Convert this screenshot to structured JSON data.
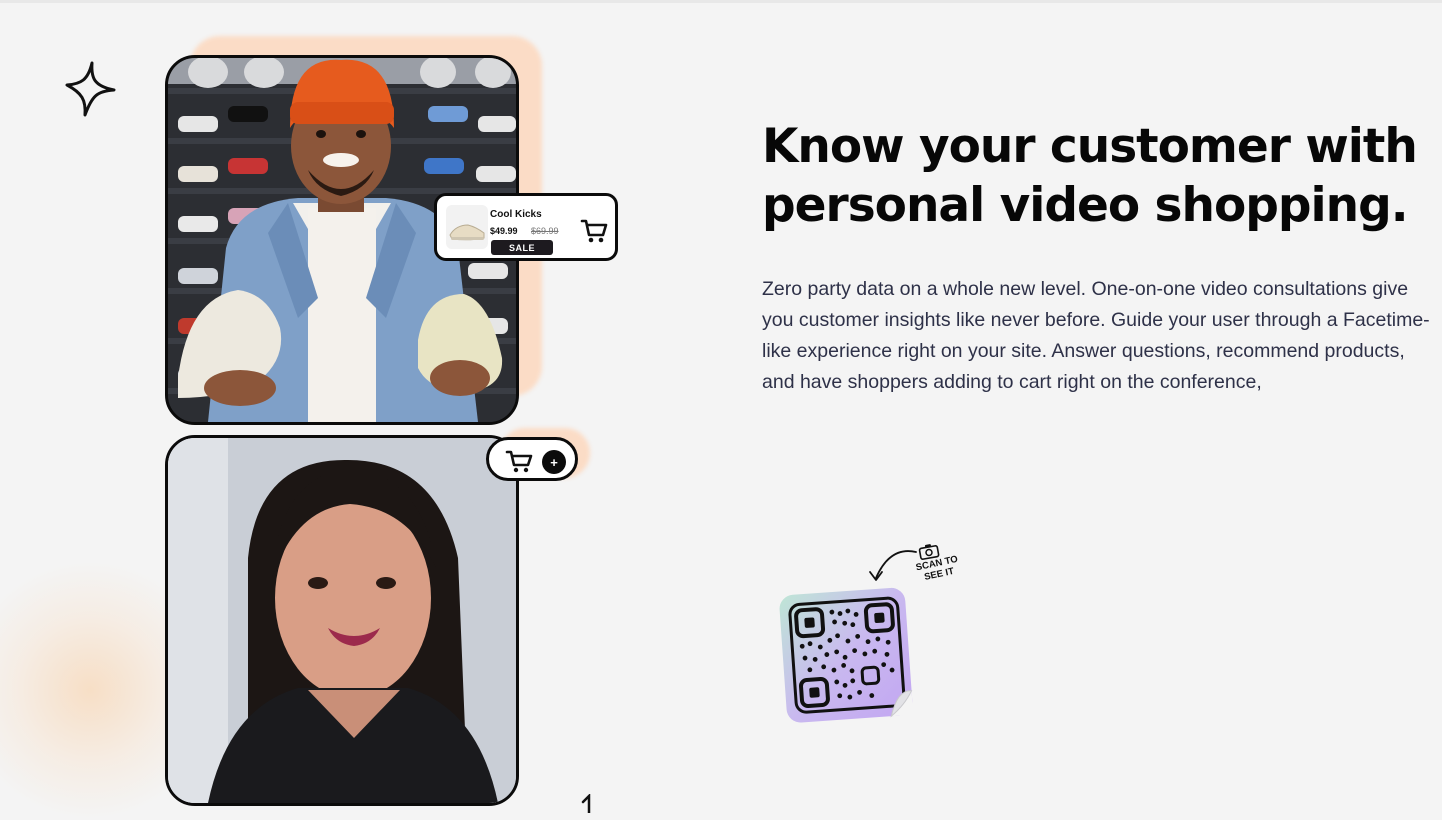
{
  "feature": {
    "headline_line1": "Know your customer with",
    "headline_line2": "personal video shopping.",
    "body": "Zero party data on a whole new level. One-on-one video consultations give you customer insights like never before. Guide your user through a Facetime-like experience right on your site. Answer questions, recommend products, and have shoppers adding to cart right on the conference,"
  },
  "product_popup": {
    "name": "Cool Kicks",
    "price": "$49.99",
    "old_price": "$69.99",
    "badge": "SALE",
    "icon": "shopping-cart-icon"
  },
  "cart_pill": {
    "icon": "shopping-cart-icon",
    "add_symbol": "+"
  },
  "qr_callout": {
    "line1": "SCAN TO",
    "line2": "SEE IT",
    "icon": "camera-icon"
  },
  "colors": {
    "background": "#f4f4f4",
    "accent_peach": "#fbdcc6",
    "text_dark": "#070707",
    "body_text": "#2e3148"
  }
}
